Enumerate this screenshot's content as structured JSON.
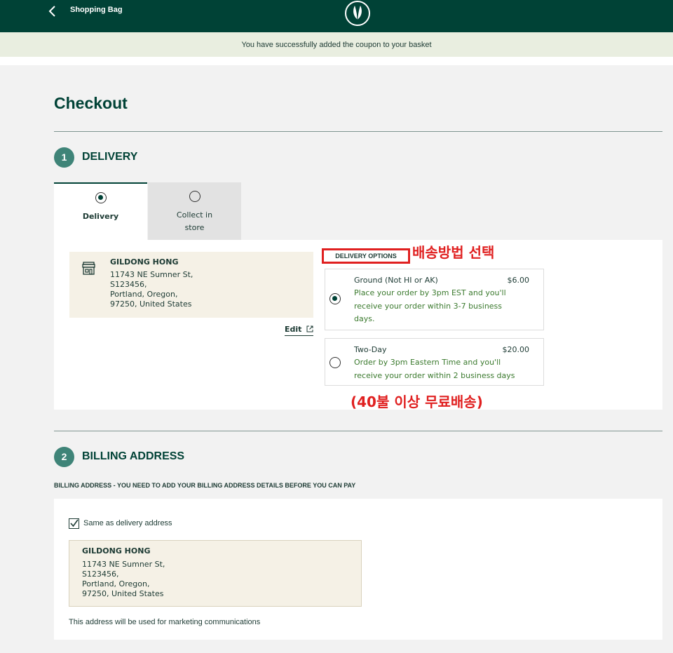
{
  "header": {
    "back_icon": "chevron-left-icon",
    "title": "Shopping Bag",
    "logo_icon": "leaf-logo-icon"
  },
  "notice": "You have successfully added the coupon to your basket",
  "page_title": "Checkout",
  "delivery": {
    "step_number": "1",
    "title": "DELIVERY",
    "tabs": [
      {
        "label": "Delivery",
        "selected": true
      },
      {
        "label_line1": "Collect in",
        "label_line2": "store",
        "selected": false
      }
    ],
    "address": {
      "name": "GILDONG HONG",
      "line1": "11743 NE Sumner St,",
      "line2": "S123456,",
      "line3": "Portland, Oregon,",
      "line4": "97250, United States"
    },
    "edit_label": "Edit",
    "options_header": "DELIVERY OPTIONS",
    "options": [
      {
        "name": "Ground (Not HI or AK)",
        "price": "$6.00",
        "desc_line1": "Place your order by 3pm EST and you'll",
        "desc_line2": "receive your order within 3-7 business",
        "desc_line3": "days.",
        "selected": true
      },
      {
        "name": "Two-Day",
        "price": "$20.00",
        "desc_line1": "Order by 3pm Eastern Time and you'll",
        "desc_line2": "receive your order within 2 business days",
        "selected": false
      }
    ]
  },
  "annotations": {
    "select_method": "배송방법 선택",
    "free_shipping": "(40불 이상 무료배송)",
    "color": "#e02020"
  },
  "billing": {
    "step_number": "2",
    "title": "BILLING ADDRESS",
    "note": "BILLING ADDRESS - YOU NEED TO ADD YOUR BILLING ADDRESS DETAILS BEFORE YOU CAN PAY",
    "same_as_label": "Same as delivery address",
    "same_checked": true,
    "address": {
      "name": "GILDONG HONG",
      "line1": "11743 NE Sumner St,",
      "line2": "S123456,",
      "line3": "Portland, Oregon,",
      "line4": "97250, United States"
    },
    "marketing_note": "This address will be used for marketing communications"
  },
  "colors": {
    "brand_green": "#004236",
    "step_circle": "#3f8478",
    "option_text": "#3b7a2e",
    "address_bg": "#f5f1e6"
  }
}
